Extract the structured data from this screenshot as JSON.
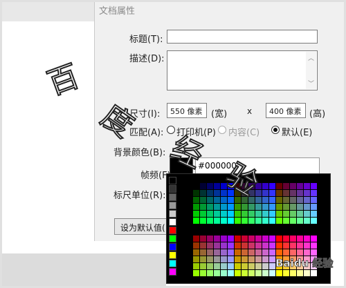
{
  "dialog": {
    "title": "文档属性",
    "fields": {
      "title_label": "标题(T):",
      "desc_label": "描述(D):",
      "size_label": "尺寸(I):",
      "width_value": "550 像素",
      "width_unit": "(宽)",
      "times": "x",
      "height_value": "400 像素",
      "height_unit": "(高)",
      "match_label": "匹配(A):",
      "radio_printer": "打印机(P)",
      "radio_content": "内容(C)",
      "radio_default": "默认(E)",
      "bg_label": "背景颜色(B):",
      "fps_label": "帧频(F):",
      "ruler_label": "标尺单位(R):",
      "set_default": "设为默认值("
    },
    "color_hex": "#000000"
  },
  "watermark": {
    "chars": [
      "百",
      "度",
      "经",
      "验"
    ],
    "brand": "Baidu 经验"
  },
  "colors": {
    "dialog_bg": "#f0f0f0",
    "swatch": "#000000"
  }
}
